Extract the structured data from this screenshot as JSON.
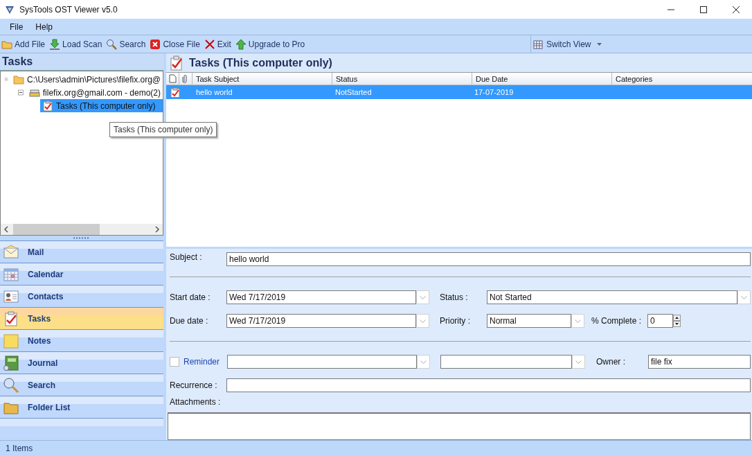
{
  "window": {
    "title": "SysTools OST Viewer v5.0"
  },
  "menu": [
    "File",
    "Help"
  ],
  "toolbar": [
    {
      "label": "Add File"
    },
    {
      "label": "Load Scan"
    },
    {
      "label": "Search"
    },
    {
      "label": "Close File"
    },
    {
      "label": "Exit"
    },
    {
      "label": "Upgrade to Pro"
    }
  ],
  "switch_view": {
    "label": "Switch View"
  },
  "folder_panel": {
    "title": "Tasks",
    "tree": [
      {
        "label": "C:\\Users\\admin\\Pictures\\filefix.org@",
        "expanded": true,
        "selected": false,
        "children": [
          {
            "label": "filefix.org@gmail.com - demo(2)",
            "expanded": true,
            "selected": false,
            "children": [
              {
                "label": "Tasks (This computer only)",
                "selected": true
              }
            ]
          }
        ]
      }
    ],
    "tooltip": "Tasks (This computer only)"
  },
  "nav": [
    {
      "label": "Mail",
      "selected": false
    },
    {
      "label": "Calendar",
      "selected": false
    },
    {
      "label": "Contacts",
      "selected": false
    },
    {
      "label": "Tasks",
      "selected": true
    },
    {
      "label": "Notes",
      "selected": false
    },
    {
      "label": "Journal",
      "selected": false
    },
    {
      "label": "Search",
      "selected": false
    },
    {
      "label": "Folder List",
      "selected": false
    }
  ],
  "content": {
    "title": "Tasks (This computer only)",
    "table": {
      "columns": [
        "Task Subject",
        "Status",
        "Due Date",
        "Categories"
      ],
      "rows": [
        {
          "subject": "hello world",
          "status": "NotStarted",
          "due_date": "17-07-2019",
          "selected": true
        }
      ]
    }
  },
  "task_form": {
    "subject": {
      "label": "Subject :",
      "value": "hello world"
    },
    "start_date": {
      "label": "Start date :",
      "value": "Wed 7/17/2019"
    },
    "status": {
      "label": "Status :",
      "value": "Not Started"
    },
    "due_date": {
      "label": "Due date :",
      "value": "Wed 7/17/2019"
    },
    "priority": {
      "label": "Priority :",
      "value": "Normal"
    },
    "percent_complete": {
      "label": "% Complete :",
      "value": "0"
    },
    "reminder": {
      "label": "Reminder",
      "checked": false
    },
    "owner": {
      "label": "Owner :",
      "value": "file fix"
    },
    "recurrence": {
      "label": "Recurrence :"
    },
    "attachments": {
      "label": "Attachments :"
    }
  },
  "status_bar": "1 Items"
}
